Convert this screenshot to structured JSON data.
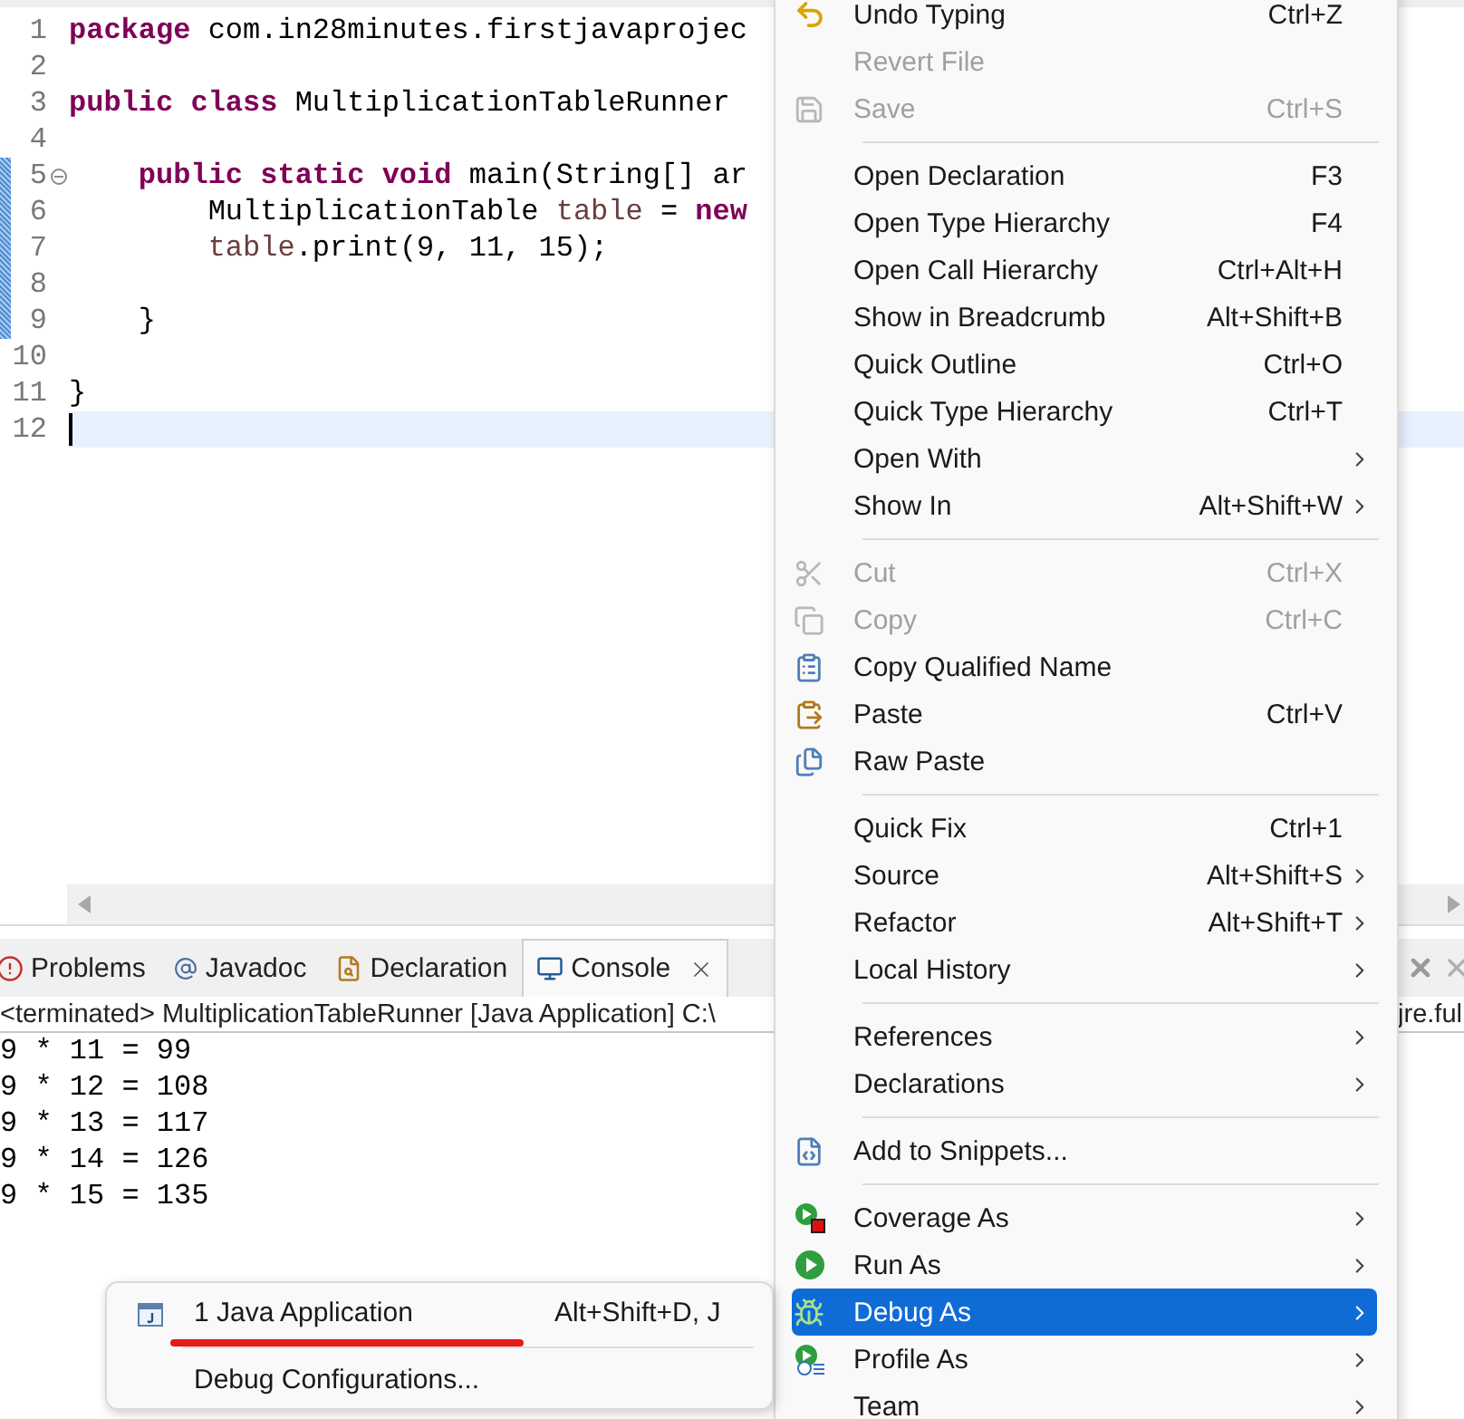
{
  "editor": {
    "lines": [
      {
        "number": "1",
        "changed": false,
        "current": false,
        "foldable": false,
        "tokens": [
          {
            "text": "package",
            "kind": "keyword"
          },
          {
            "text": " com.in28minutes.firstjavaprojec",
            "kind": "plain"
          }
        ]
      },
      {
        "number": "2",
        "changed": false,
        "current": false,
        "foldable": false
      },
      {
        "number": "3",
        "changed": false,
        "current": false,
        "foldable": false,
        "tokens": [
          {
            "text": "public class",
            "kind": "keyword"
          },
          {
            "text": " MultiplicationTableRunner",
            "kind": "plain"
          }
        ]
      },
      {
        "number": "4",
        "changed": false,
        "current": false,
        "foldable": false
      },
      {
        "number": "5",
        "changed": true,
        "current": false,
        "foldable": true,
        "tokens": [
          {
            "text": "    public static void",
            "kind": "keyword"
          },
          {
            "text": " main(String[] ar",
            "kind": "plain"
          }
        ]
      },
      {
        "number": "6",
        "changed": true,
        "current": false,
        "foldable": false,
        "tokens": [
          {
            "text": "        MultiplicationTable ",
            "kind": "plain"
          },
          {
            "text": "table",
            "kind": "variable"
          },
          {
            "text": " = ",
            "kind": "plain"
          },
          {
            "text": "new",
            "kind": "keyword"
          }
        ]
      },
      {
        "number": "7",
        "changed": true,
        "current": false,
        "foldable": false,
        "tokens": [
          {
            "text": "        table",
            "kind": "variable"
          },
          {
            "text": ".print(9, 11, 15);",
            "kind": "plain"
          }
        ]
      },
      {
        "number": "8",
        "changed": true,
        "current": false,
        "foldable": false
      },
      {
        "number": "9",
        "changed": true,
        "current": false,
        "foldable": false,
        "tokens": [
          {
            "text": "    }",
            "kind": "plain"
          }
        ]
      },
      {
        "number": "10",
        "changed": false,
        "current": false,
        "foldable": false
      },
      {
        "number": "11",
        "changed": false,
        "current": false,
        "foldable": false,
        "tokens": [
          {
            "text": "}",
            "kind": "plain"
          }
        ]
      },
      {
        "number": "12",
        "changed": false,
        "current": true,
        "foldable": false
      }
    ]
  },
  "panel": {
    "tabs": [
      {
        "label": "Problems",
        "selected": false
      },
      {
        "label": "Javadoc",
        "selected": false
      },
      {
        "label": "Declaration",
        "selected": false
      },
      {
        "label": "Console",
        "selected": true
      }
    ],
    "status_left": "<terminated> MultiplicationTableRunner [Java Application] C:\\",
    "status_right": "jre.ful",
    "output": [
      "9 * 11 = 99",
      "9 * 12 = 108",
      "9 * 13 = 117",
      "9 * 14 = 126",
      "9 * 15 = 135"
    ]
  },
  "context_menu": {
    "groups": [
      [
        {
          "label": "Undo Typing",
          "shortcut": "Ctrl+Z",
          "disabled": false,
          "submenu": false,
          "selected": false
        },
        {
          "label": "Revert File",
          "disabled": true,
          "submenu": false,
          "selected": false
        },
        {
          "label": "Save",
          "shortcut": "Ctrl+S",
          "disabled": true,
          "submenu": false,
          "selected": false
        }
      ],
      [
        {
          "label": "Open Declaration",
          "shortcut": "F3",
          "disabled": false,
          "submenu": false,
          "selected": false
        },
        {
          "label": "Open Type Hierarchy",
          "shortcut": "F4",
          "disabled": false,
          "submenu": false,
          "selected": false
        },
        {
          "label": "Open Call Hierarchy",
          "shortcut": "Ctrl+Alt+H",
          "disabled": false,
          "submenu": false,
          "selected": false
        },
        {
          "label": "Show in Breadcrumb",
          "shortcut": "Alt+Shift+B",
          "disabled": false,
          "submenu": false,
          "selected": false
        },
        {
          "label": "Quick Outline",
          "shortcut": "Ctrl+O",
          "disabled": false,
          "submenu": false,
          "selected": false
        },
        {
          "label": "Quick Type Hierarchy",
          "shortcut": "Ctrl+T",
          "disabled": false,
          "submenu": false,
          "selected": false
        },
        {
          "label": "Open With",
          "disabled": false,
          "submenu": true,
          "selected": false
        },
        {
          "label": "Show In",
          "shortcut": "Alt+Shift+W",
          "disabled": false,
          "submenu": true,
          "selected": false
        }
      ],
      [
        {
          "label": "Cut",
          "shortcut": "Ctrl+X",
          "disabled": true,
          "submenu": false,
          "selected": false
        },
        {
          "label": "Copy",
          "shortcut": "Ctrl+C",
          "disabled": true,
          "submenu": false,
          "selected": false
        },
        {
          "label": "Copy Qualified Name",
          "disabled": false,
          "submenu": false,
          "selected": false
        },
        {
          "label": "Paste",
          "shortcut": "Ctrl+V",
          "disabled": false,
          "submenu": false,
          "selected": false
        },
        {
          "label": "Raw Paste",
          "disabled": false,
          "submenu": false,
          "selected": false
        }
      ],
      [
        {
          "label": "Quick Fix",
          "shortcut": "Ctrl+1",
          "disabled": false,
          "submenu": false,
          "selected": false
        },
        {
          "label": "Source",
          "shortcut": "Alt+Shift+S",
          "disabled": false,
          "submenu": true,
          "selected": false
        },
        {
          "label": "Refactor",
          "shortcut": "Alt+Shift+T",
          "disabled": false,
          "submenu": true,
          "selected": false
        },
        {
          "label": "Local History",
          "disabled": false,
          "submenu": true,
          "selected": false
        }
      ],
      [
        {
          "label": "References",
          "disabled": false,
          "submenu": true,
          "selected": false
        },
        {
          "label": "Declarations",
          "disabled": false,
          "submenu": true,
          "selected": false
        }
      ],
      [
        {
          "label": "Add to Snippets...",
          "disabled": false,
          "submenu": false,
          "selected": false
        }
      ],
      [
        {
          "label": "Coverage As",
          "disabled": false,
          "submenu": true,
          "selected": false
        },
        {
          "label": "Run As",
          "disabled": false,
          "submenu": true,
          "selected": false
        },
        {
          "label": "Debug As",
          "disabled": false,
          "submenu": true,
          "selected": true
        },
        {
          "label": "Profile As",
          "disabled": false,
          "submenu": true,
          "selected": false
        },
        {
          "label": "Team",
          "disabled": false,
          "submenu": true,
          "selected": false
        }
      ]
    ]
  },
  "submenu": {
    "groups": [
      [
        {
          "label": "1 Java Application",
          "shortcut": "Alt+Shift+D, J",
          "selected": false
        }
      ],
      [
        {
          "label": "Debug Configurations...",
          "selected": false
        }
      ]
    ]
  }
}
